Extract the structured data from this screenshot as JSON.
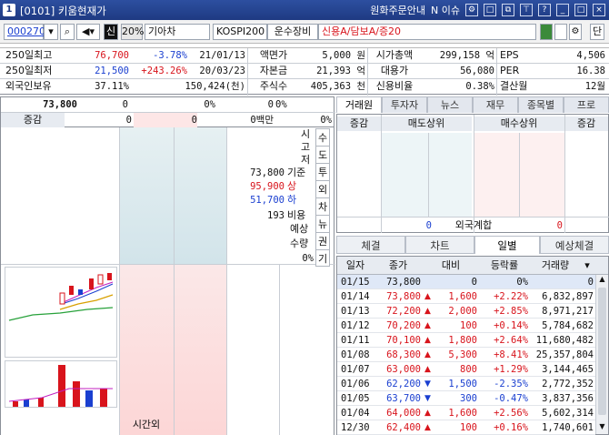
{
  "window": {
    "title": "[0101] 키움현재가",
    "icon_label": "1",
    "notice": "원화주문안내",
    "issue": "N 이슈"
  },
  "toolbar": {
    "code": "000270",
    "pct": "20%",
    "name": "기아차",
    "market": "KOSPI200",
    "sector": "운수장비",
    "credit": "신용A/담보A/증20",
    "sin_label": "신",
    "unit_label": "단"
  },
  "info": {
    "r1": {
      "label": "250일최고",
      "price": "76,700",
      "pct": "-3.78%",
      "date": "21/01/13",
      "k1": "액면가",
      "v1": "5,000 원",
      "k2": "시가총액",
      "v2": "299,158 억",
      "k3": "EPS",
      "v3": "4,506"
    },
    "r2": {
      "label": "250일최저",
      "price": "21,500",
      "pct": "+243.26%",
      "date": "20/03/23",
      "k1": "자본금",
      "v1": "21,393 억",
      "k2": "대용가",
      "v2": "56,080",
      "k3": "PER",
      "v3": "16.38"
    },
    "r3": {
      "label": "외국인보유",
      "pct": "37.11%",
      "shares": "150,424(천)",
      "k1": "주식수",
      "v1": "405,363 천",
      "k2": "신용비율",
      "v2": "0.38%",
      "k3": "결산월",
      "v3": "12월"
    }
  },
  "quote": {
    "price": "73,800",
    "chg": "0",
    "pct": "0%",
    "vol": "0",
    "pct2": "0%",
    "label_chg": "증감",
    "v0a": "0",
    "v0b": "0",
    "money": "0백만",
    "pct3": "0%"
  },
  "side": {
    "open_label": "시",
    "high_label": "고",
    "low_label": "저",
    "base_price": "73,800",
    "base_label": "기준",
    "upper_price": "95,900",
    "upper_label": "상",
    "lower_price": "51,700",
    "lower_label": "하",
    "ratio_val": "193",
    "ratio_label": "비용",
    "exp_label1": "예상",
    "exp_label2": "수량",
    "exp_pct": "0%"
  },
  "vtabs": [
    "수",
    "도",
    "투",
    "외",
    "차",
    "뉴",
    "권",
    "기"
  ],
  "bottom_label": "시간외",
  "rtabs": [
    "거래원",
    "투자자",
    "뉴스",
    "재무",
    "종목별",
    "프로"
  ],
  "broker": {
    "h_chg": "증감",
    "h_sell": "매도상위",
    "h_buy": "매수상위",
    "h_chg2": "증감",
    "foreign_label": "외국계합",
    "foreign_sell": "0",
    "foreign_buy": "0"
  },
  "dtabs": [
    "체결",
    "차트",
    "일별",
    "예상체결"
  ],
  "daily": {
    "headers": [
      "일자",
      "종가",
      "대비",
      "등락률",
      "거래량"
    ],
    "rows": [
      {
        "d": "01/15",
        "p": "73,800",
        "dir": "",
        "c": "0",
        "r": "0%",
        "v": "0"
      },
      {
        "d": "01/14",
        "p": "73,800",
        "dir": "up",
        "c": "1,600",
        "r": "+2.22%",
        "v": "6,832,897"
      },
      {
        "d": "01/13",
        "p": "72,200",
        "dir": "up",
        "c": "2,000",
        "r": "+2.85%",
        "v": "8,971,217"
      },
      {
        "d": "01/12",
        "p": "70,200",
        "dir": "up",
        "c": "100",
        "r": "+0.14%",
        "v": "5,784,682"
      },
      {
        "d": "01/11",
        "p": "70,100",
        "dir": "up",
        "c": "1,800",
        "r": "+2.64%",
        "v": "11,680,482"
      },
      {
        "d": "01/08",
        "p": "68,300",
        "dir": "up",
        "c": "5,300",
        "r": "+8.41%",
        "v": "25,357,804"
      },
      {
        "d": "01/07",
        "p": "63,000",
        "dir": "up",
        "c": "800",
        "r": "+1.29%",
        "v": "3,144,465"
      },
      {
        "d": "01/06",
        "p": "62,200",
        "dir": "down",
        "c": "1,500",
        "r": "-2.35%",
        "v": "2,772,352"
      },
      {
        "d": "01/05",
        "p": "63,700",
        "dir": "down",
        "c": "300",
        "r": "-0.47%",
        "v": "3,837,356"
      },
      {
        "d": "01/04",
        "p": "64,000",
        "dir": "up",
        "c": "1,600",
        "r": "+2.56%",
        "v": "5,602,314"
      },
      {
        "d": "12/30",
        "p": "62,400",
        "dir": "up",
        "c": "100",
        "r": "+0.16%",
        "v": "1,740,601"
      }
    ]
  }
}
